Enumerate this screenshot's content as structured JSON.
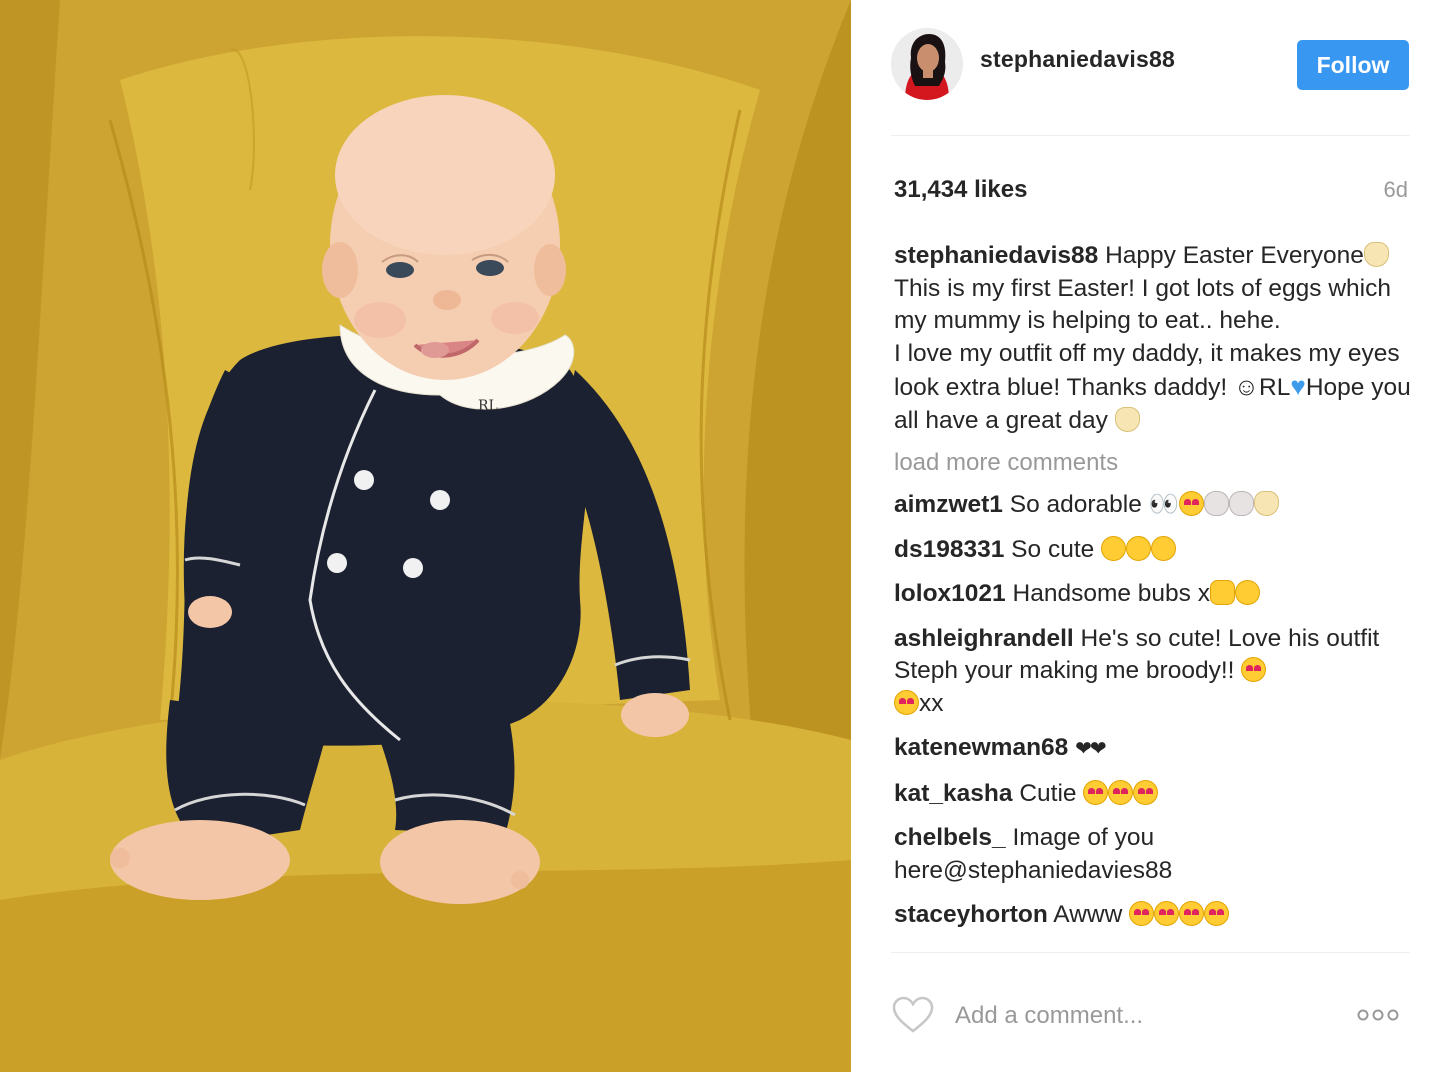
{
  "post": {
    "photo": {
      "alt_subject": "baby-on-yellow-armchair"
    },
    "author": {
      "username": "stephaniedavis88",
      "avatar_icon": "profile-photo"
    },
    "follow_label": "Follow",
    "likes": "31,434 likes",
    "age": "6d",
    "caption": {
      "user": "stephaniedavis88",
      "part1": " Happy Easter Everyone",
      "part2": "This is my first Easter! I got lots of eggs which my mummy is helping to eat.. hehe.",
      "part3": "I love my outfit off my daddy, it makes my eyes look extra blue! Thanks daddy! ",
      "part4": "☺RL",
      "part5": "Hope you all have a great day "
    },
    "load_more": "load more comments",
    "comments": [
      {
        "user": "aimzwet1",
        "text": " So adorable ",
        "emoji_text": "👀"
      },
      {
        "user": "ds198331",
        "text": " So cute "
      },
      {
        "user": "lolox1021",
        "text": " Handsome bubs x"
      },
      {
        "user": "ashleighrandell",
        "text": " He's so cute! Love his outfit Steph your making me broody!! ",
        "tail": "xx"
      },
      {
        "user": "katenewman68",
        "text": " ",
        "hearts": "❤❤"
      },
      {
        "user": "kat_kasha",
        "text": " Cutie "
      },
      {
        "user": "chelbels_",
        "text": " Image of you here@stephaniedavies88"
      },
      {
        "user": "staceyhorton",
        "text": " Awww "
      }
    ],
    "add_comment_placeholder": "Add a comment...",
    "icons": {
      "like": "heart-outline-icon",
      "more": "more-options-icon"
    }
  },
  "colors": {
    "follow_bg": "#3897f0",
    "muted": "#999999",
    "chair": "#d3ad2c",
    "onesie": "#1c2233"
  }
}
